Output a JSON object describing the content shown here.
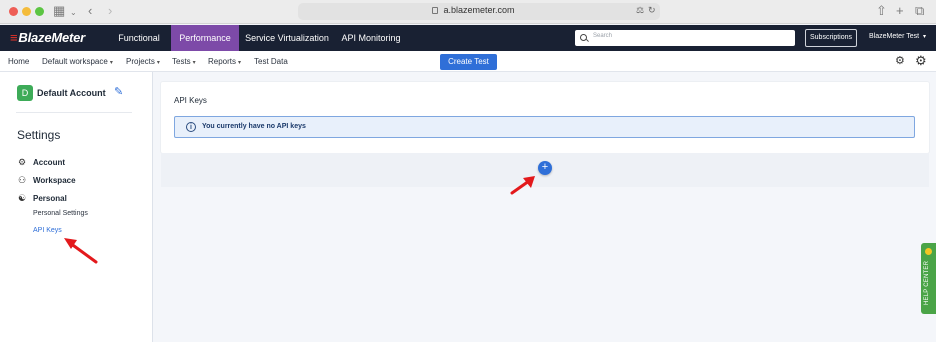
{
  "browser": {
    "url": "a.blazemeter.com"
  },
  "topnav": {
    "logo": "BlazeMeter",
    "tabs": [
      {
        "label": "Functional"
      },
      {
        "label": "Performance"
      },
      {
        "label": "Service Virtualization"
      },
      {
        "label": "API Monitoring"
      }
    ],
    "search_placeholder": "Search",
    "subscriptions_label": "Subscriptions",
    "user_label": "BlazeMeter Test"
  },
  "subnav": {
    "items": [
      {
        "label": "Home"
      },
      {
        "label": "Default workspace"
      },
      {
        "label": "Projects"
      },
      {
        "label": "Tests"
      },
      {
        "label": "Reports"
      },
      {
        "label": "Test Data"
      }
    ],
    "create_test_label": "Create Test"
  },
  "sidebar": {
    "avatar_letter": "D",
    "account_name": "Default Account",
    "settings_title": "Settings",
    "sections": [
      {
        "label": "Account"
      },
      {
        "label": "Workspace"
      },
      {
        "label": "Personal"
      }
    ],
    "personal_items": [
      {
        "label": "Personal Settings"
      },
      {
        "label": "API Keys"
      }
    ]
  },
  "main": {
    "card_title": "API Keys",
    "info_message": "You currently have no API keys",
    "add_button_symbol": "+"
  },
  "help_center": {
    "label": "HELP CENTER"
  },
  "colors": {
    "nav_bg": "#192133",
    "active_tab": "#7d4aa8",
    "primary": "#2f6fd8",
    "avatar": "#3dab58",
    "help": "#4aa447",
    "annotation": "#e3191c"
  },
  "icons": [
    "search-icon",
    "edit-pencil-icon",
    "account-icon",
    "workspace-icon",
    "personal-icon",
    "info-icon",
    "plus-icon",
    "settings-gear-icon",
    "user-settings-icon",
    "annotation-arrow"
  ]
}
